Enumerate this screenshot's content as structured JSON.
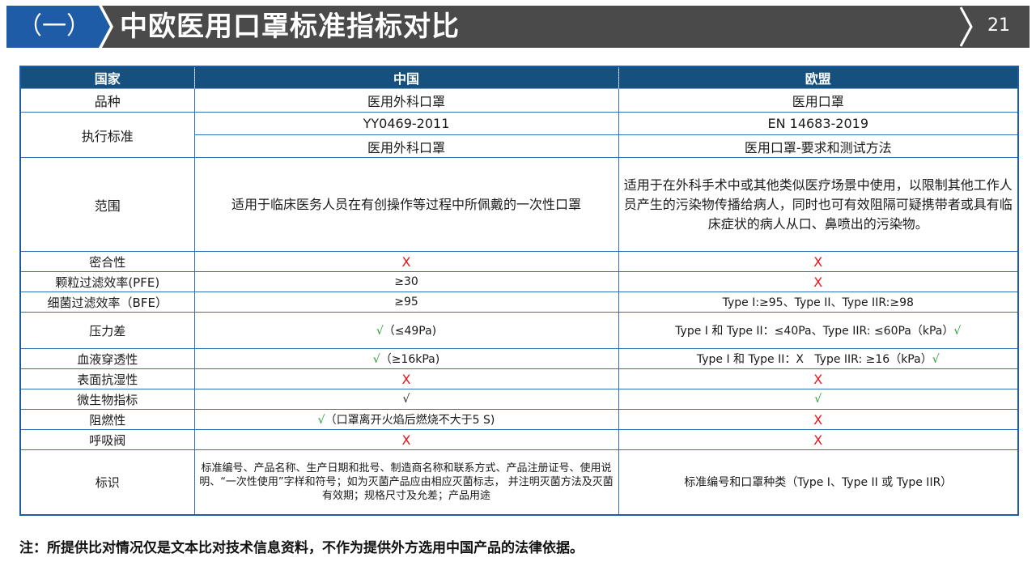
{
  "header": {
    "section_number": "（一）",
    "title": "中欧医用口罩标准指标对比",
    "page_number": "21"
  },
  "table": {
    "headers": [
      "国家",
      "中国",
      "欧盟"
    ],
    "variety": {
      "label": "品种",
      "cn": "医用外科口罩",
      "eu": "医用口罩"
    },
    "standard": {
      "label": "执行标准",
      "cn_code": "YY0469-2011",
      "eu_code": "EN 14683-2019",
      "cn_name": "医用外科口罩",
      "eu_name": "医用口罩-要求和测试方法"
    },
    "scope": {
      "label": "范围",
      "cn": "适用于临床医务人员在有创操作等过程中所佩戴的一次性口罩",
      "eu": "适用于在外科手术中或其他类似医疗场景中使用，以限制其他工作人员产生的污染物传播给病人，同时也可有效阻隔可疑携带者或具有临床症状的病人从口、鼻喷出的污染物。"
    },
    "rows": [
      {
        "label": "密合性",
        "cn": "X",
        "eu": "X"
      },
      {
        "label": "颗粒过滤效率(PFE)",
        "cn": "≥30",
        "eu": "X"
      },
      {
        "label": "细菌过滤效率（BFE）",
        "cn": "≥95",
        "eu": "Type I:≥95、Type II、Type IIR:≥98"
      },
      {
        "label": "压力差",
        "cn_mark": "√",
        "cn": "（≤49Pa)",
        "eu": "Type I 和 Type II：≤40Pa、Type IIR: ≤60Pa（kPa）",
        "eu_mark": "√"
      },
      {
        "label": "血液穿透性",
        "cn_mark": "√",
        "cn": "（≥16kPa)",
        "eu": "Type I 和 Type II：X   Type IIR: ≥16（kPa）",
        "eu_mark": "√"
      },
      {
        "label": "表面抗湿性",
        "cn": "X",
        "eu": "X"
      },
      {
        "label": "微生物指标",
        "cn": "√",
        "eu": "√"
      },
      {
        "label": "阻燃性",
        "cn_mark": "√",
        "cn": "（口罩离开火焰后燃烧不大于5 S)",
        "eu": "X"
      },
      {
        "label": "呼吸阀",
        "cn": "X",
        "eu": "X"
      }
    ],
    "marking": {
      "label": "标识",
      "cn": "标准编号、产品名称、生产日期和批号、制造商名称和联系方式、产品注册证号、使用说明、“一次性使用”字样和符号；如为灭菌产品应由相应灭菌标志， 并注明灭菌方法及灭菌有效期；规格尺寸及允差；产品用途",
      "eu": "标准编号和口罩种类（Type I、Type II 或 Type IIR）"
    }
  },
  "note": "注：所提供比对情况仅是文本比对技术信息资料，不作为提供外方选用中国产品的法律依据。",
  "colors": {
    "header_blue": "#1f5ca8",
    "header_gray": "#4a4a4a",
    "table_header": "#16507e",
    "cross_red": "#e8141a",
    "check_green": "#1aa02a"
  }
}
